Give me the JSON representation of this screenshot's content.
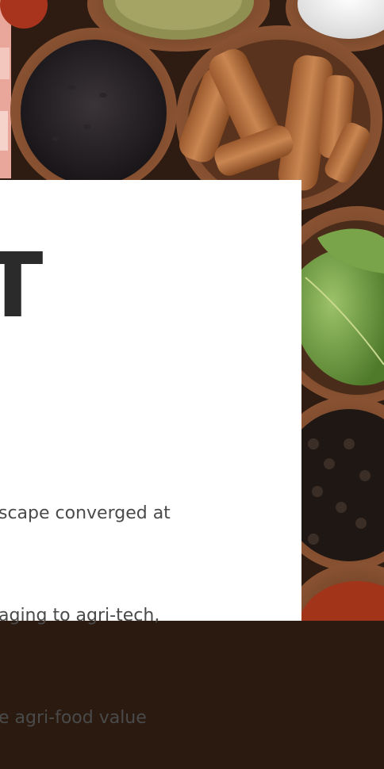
{
  "hero": {
    "title_fragment": "T",
    "paragraph_lines": [
      "scape converged at",
      "aging to agri-tech,",
      "e agri-food value"
    ]
  },
  "colors": {
    "card_background": "#ffffff",
    "heading": "#2b2b2b",
    "body_text": "#4a4a4a",
    "wood_background": "#2a1a10"
  }
}
